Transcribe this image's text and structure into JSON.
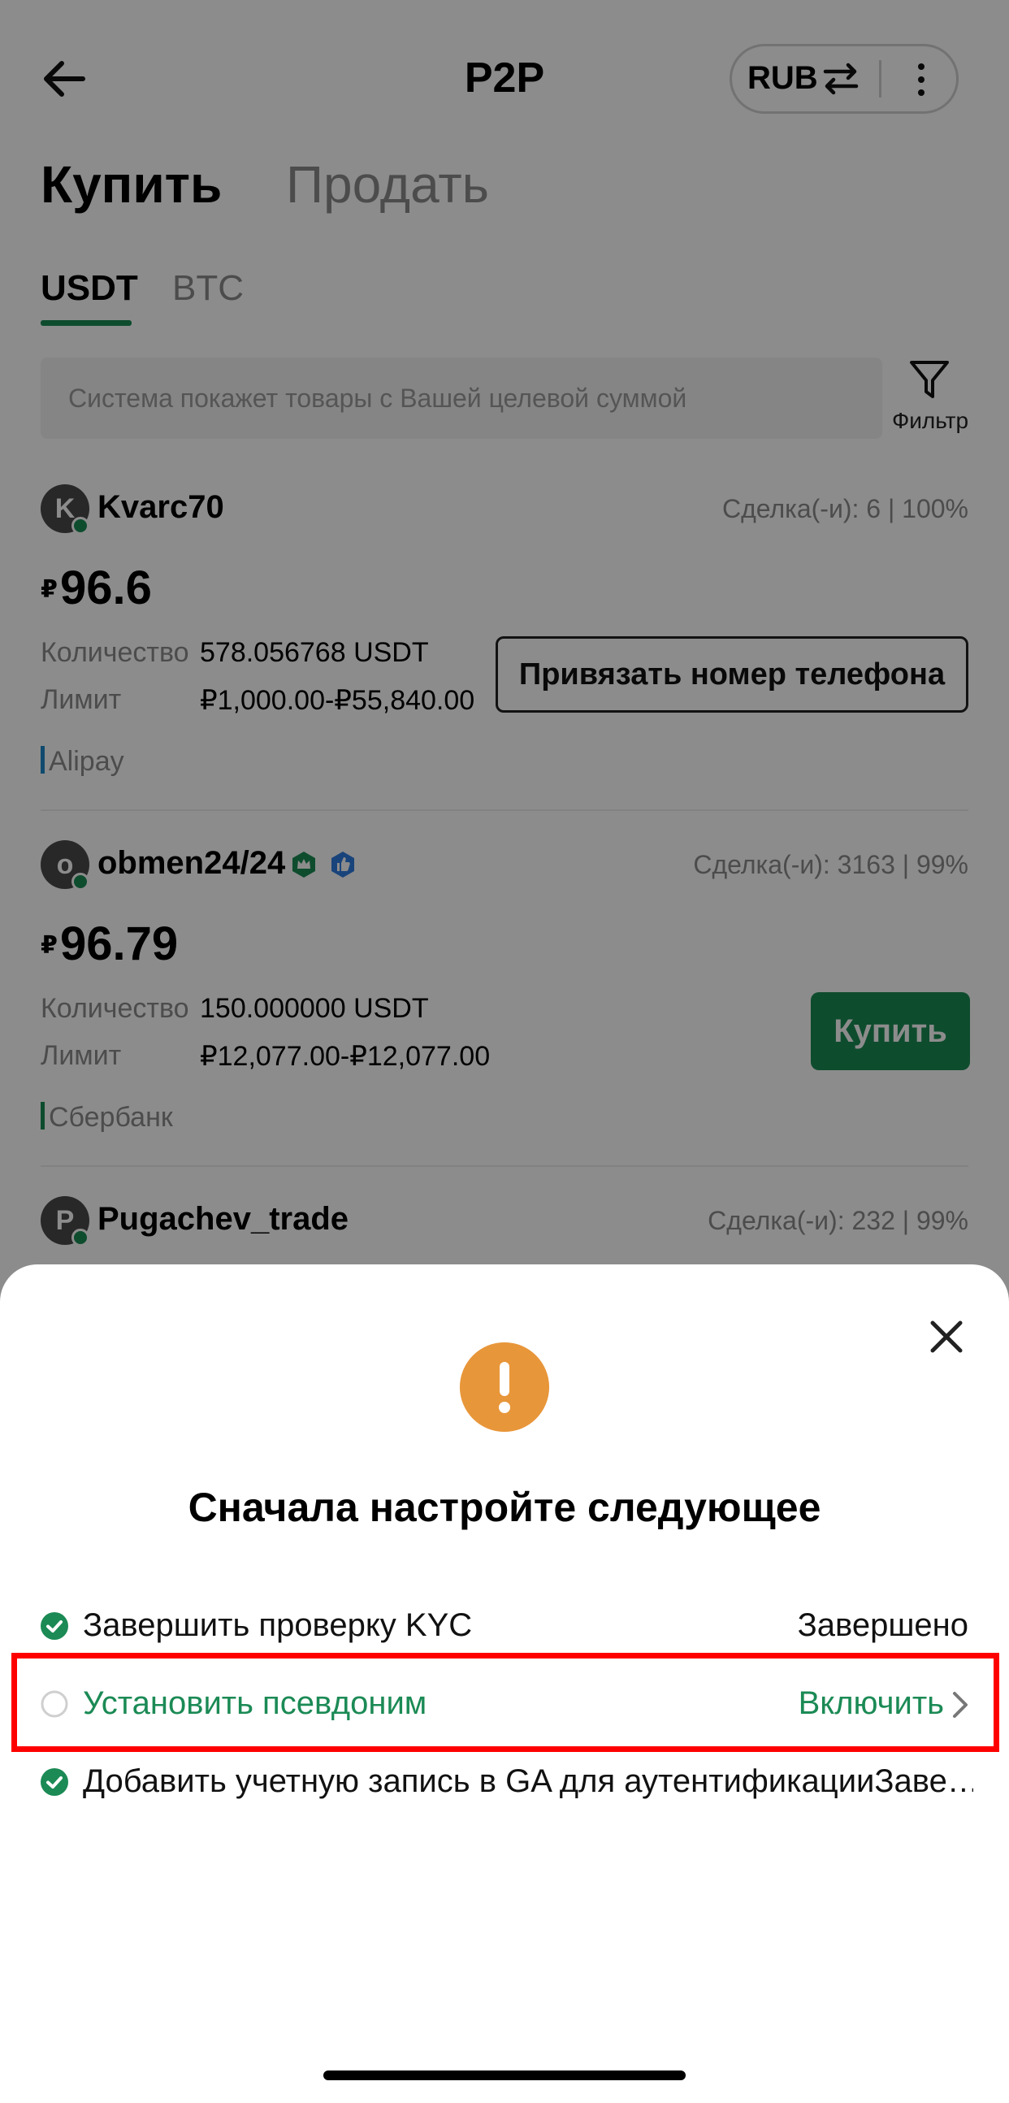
{
  "header": {
    "title": "P2P",
    "currency": "RUB"
  },
  "tabs": {
    "buy": "Купить",
    "sell": "Продать"
  },
  "coin_tabs": [
    "USDT",
    "BTC"
  ],
  "search": {
    "placeholder": "Система покажет товары с Вашей целевой суммой"
  },
  "filter_label": "Фильтр",
  "labels": {
    "quantity": "Количество",
    "limit": "Лимит",
    "currency_symbol": "₽"
  },
  "offers": [
    {
      "initial": "K",
      "name": "Kvarc70",
      "deals": "Сделка(-и): 6 | 100%",
      "price": "96.6",
      "quantity": "578.056768 USDT",
      "limit": "₽1,000.00-₽55,840.00",
      "payment": "Alipay",
      "payment_color": "#1e88c8",
      "action": "Привязать номер телефона"
    },
    {
      "initial": "o",
      "name": "obmen24/24",
      "deals": "Сделка(-и): 3163 | 99%",
      "price": "96.79",
      "quantity": "150.000000 USDT",
      "limit": "₽12,077.00-₽12,077.00",
      "payment": "Сбербанк",
      "payment_color": "#1b8a55",
      "action": "Купить"
    },
    {
      "initial": "P",
      "name": "Pugachev_trade",
      "deals": "Сделка(-и): 232 | 99%"
    }
  ],
  "sheet": {
    "title": "Сначала настройте следующее",
    "items": [
      {
        "label": "Завершить проверку KYC",
        "status": "Завершено",
        "done": true
      },
      {
        "label": "Установить псевдоним",
        "status": "Включить",
        "done": false
      },
      {
        "label": "Добавить учетную запись в GA для аутентификацииЗаве…",
        "status": "",
        "done": true
      }
    ]
  },
  "colors": {
    "accent": "#1b8a55",
    "warning": "#e8963a",
    "highlight": "#ff0000"
  }
}
